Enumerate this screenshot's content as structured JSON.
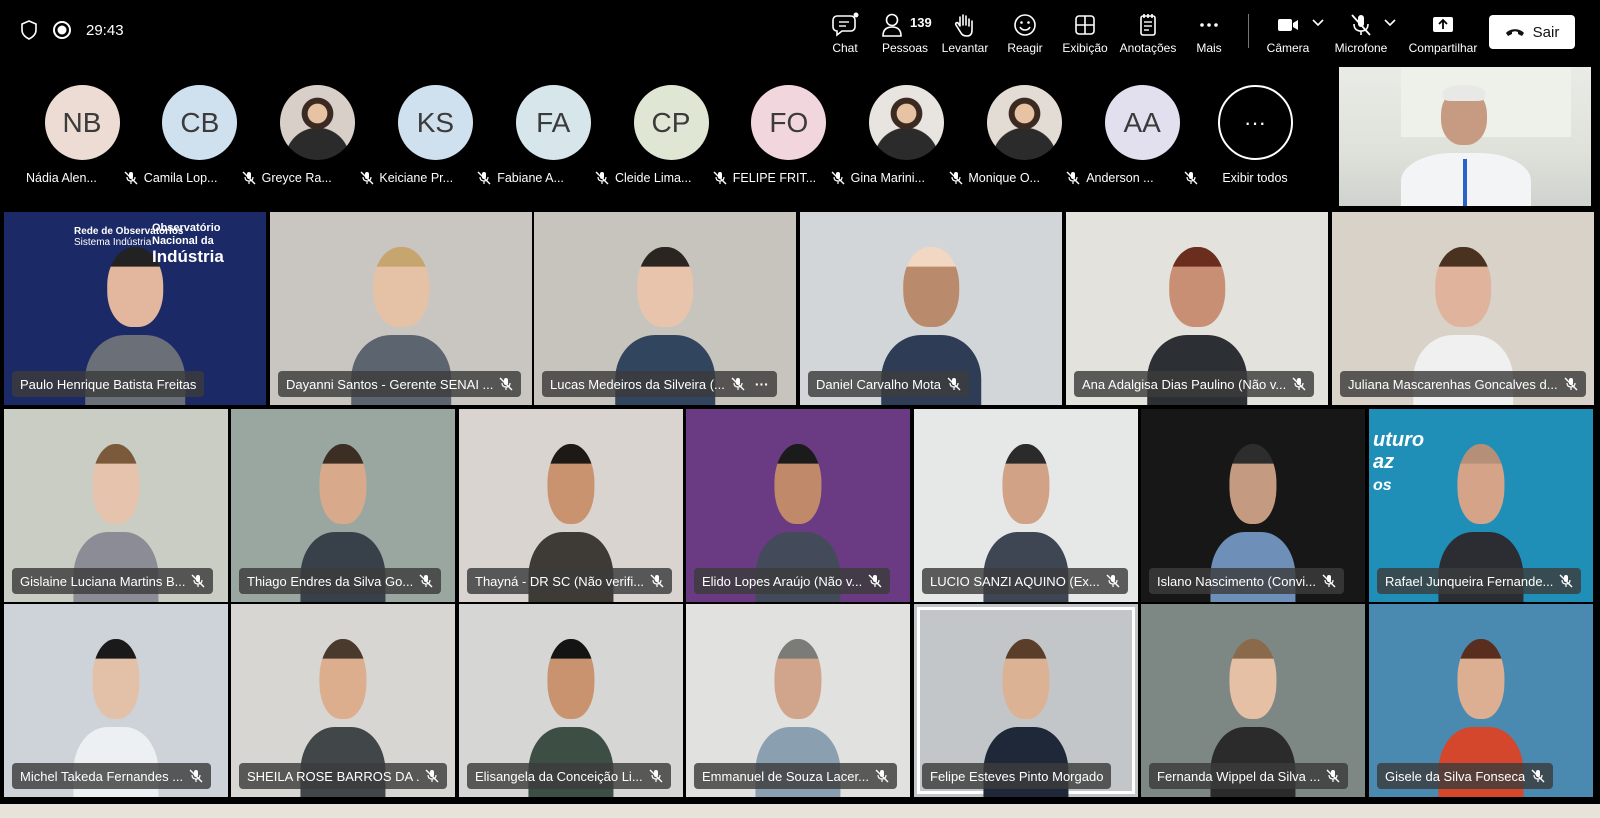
{
  "toolbar": {
    "timer": "29:43",
    "chat": "Chat",
    "people": "Pessoas",
    "people_count": "139",
    "raise": "Levantar",
    "react": "Reagir",
    "view": "Exibição",
    "notes": "Anotações",
    "more": "Mais",
    "camera": "Câmera",
    "mic": "Microfone",
    "share": "Compartilhar",
    "leave": "Sair"
  },
  "avatars": [
    {
      "initials": "NB",
      "name": "Nádia Alen...",
      "color": "#ecdcd3"
    },
    {
      "initials": "CB",
      "name": "Camila Lop...",
      "color": "#cfe0ee"
    },
    {
      "initials": "",
      "name": "Greyce Ra...",
      "color": "#d8d0c8",
      "icon": "photo"
    },
    {
      "initials": "KS",
      "name": "Keiciane Pr...",
      "color": "#cfe0ee"
    },
    {
      "initials": "FA",
      "name": "Fabiane A...",
      "color": "#d6e6ea"
    },
    {
      "initials": "CP",
      "name": "Cleide Lima...",
      "color": "#dfe6d4"
    },
    {
      "initials": "FO",
      "name": "FELIPE FRIT...",
      "color": "#f2d6de"
    },
    {
      "initials": "",
      "name": "Gina Marini...",
      "color": "#e8e4e0",
      "icon": "photo"
    },
    {
      "initials": "",
      "name": "Monique O...",
      "color": "#e2dcd4",
      "icon": "photo"
    },
    {
      "initials": "AA",
      "name": "Anderson ...",
      "color": "#e2e0ee"
    }
  ],
  "show_all": {
    "label": "Exibir todos",
    "glyph": "···"
  },
  "participants": [
    {
      "name": "Paulo Henrique Batista Freitas",
      "muted": false
    },
    {
      "name": "Dayanni Santos - Gerente SENAI ...",
      "muted": true
    },
    {
      "name": "Lucas Medeiros da Silveira (...",
      "muted": true,
      "more": "···"
    },
    {
      "name": "Daniel Carvalho Mota",
      "muted": true
    },
    {
      "name": "Ana Adalgisa Dias Paulino (Não v...",
      "muted": true
    },
    {
      "name": "Juliana Mascarenhas Goncalves d...",
      "muted": true
    },
    {
      "name": "Gislaine Luciana Martins B...",
      "muted": true
    },
    {
      "name": "Thiago Endres da Silva Go...",
      "muted": true
    },
    {
      "name": "Thayná - DR SC (Não verifi...",
      "muted": true
    },
    {
      "name": "Elido Lopes Araújo (Não v...",
      "muted": true
    },
    {
      "name": "LUCIO SANZI AQUINO (Ex...",
      "muted": true
    },
    {
      "name": "Islano Nascimento (Convi...",
      "muted": true
    },
    {
      "name": "Rafael Junqueira Fernande...",
      "muted": true
    },
    {
      "name": "Michel Takeda Fernandes ...",
      "muted": true
    },
    {
      "name": "SHEILA ROSE BARROS DA ...",
      "muted": true
    },
    {
      "name": "Elisangela da Conceição Li...",
      "muted": true
    },
    {
      "name": "Emmanuel de Souza Lacer...",
      "muted": true
    },
    {
      "name": "Felipe Esteves Pinto Morgado",
      "muted": false,
      "speaking": true
    },
    {
      "name": "Fernanda Wippel da Silva ...",
      "muted": true
    },
    {
      "name": "Gisele da Silva Fonseca",
      "muted": true
    }
  ],
  "background_text": {
    "network_title": "Rede de Observatórios",
    "network_sub": "Sistema Indústria",
    "observatory_line1": "Observatório",
    "observatory_line2": "Nacional da",
    "observatory_line3": "Indústria",
    "rafael_bg_line1": "uturo",
    "rafael_bg_line2": "az",
    "rafael_bg_line3": "os"
  }
}
